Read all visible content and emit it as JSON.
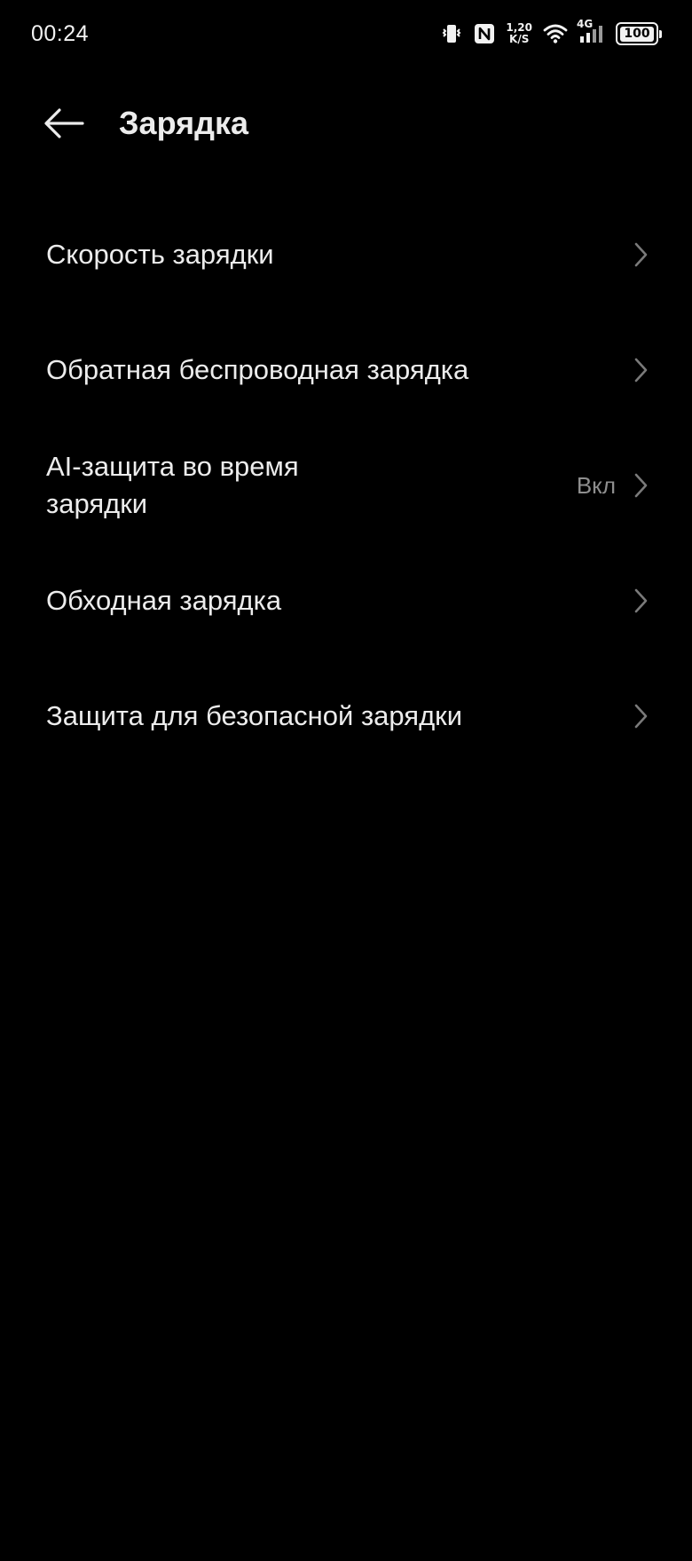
{
  "status_bar": {
    "time": "00:24",
    "net_speed_value": "1,20",
    "net_speed_unit": "K/S",
    "network_type": "4G",
    "battery_level": "100",
    "icons": [
      "vibrate-icon",
      "nfc-icon",
      "wifi-icon",
      "cellular-signal-icon",
      "battery-icon"
    ]
  },
  "header": {
    "title": "Зарядка",
    "back_icon": "back-arrow-icon"
  },
  "settings": {
    "items": [
      {
        "label": "Скорость зарядки",
        "value": ""
      },
      {
        "label": "Обратная беспроводная зарядка",
        "value": ""
      },
      {
        "label": "AI-защита во время зарядки",
        "value": "Вкл"
      },
      {
        "label": "Обходная зарядка",
        "value": ""
      },
      {
        "label": "Защита для безопасной зарядки",
        "value": ""
      }
    ]
  },
  "colors": {
    "background": "#000000",
    "text_primary": "#ececec",
    "text_secondary": "#8e8e8e",
    "chevron": "#7a7a7a"
  }
}
